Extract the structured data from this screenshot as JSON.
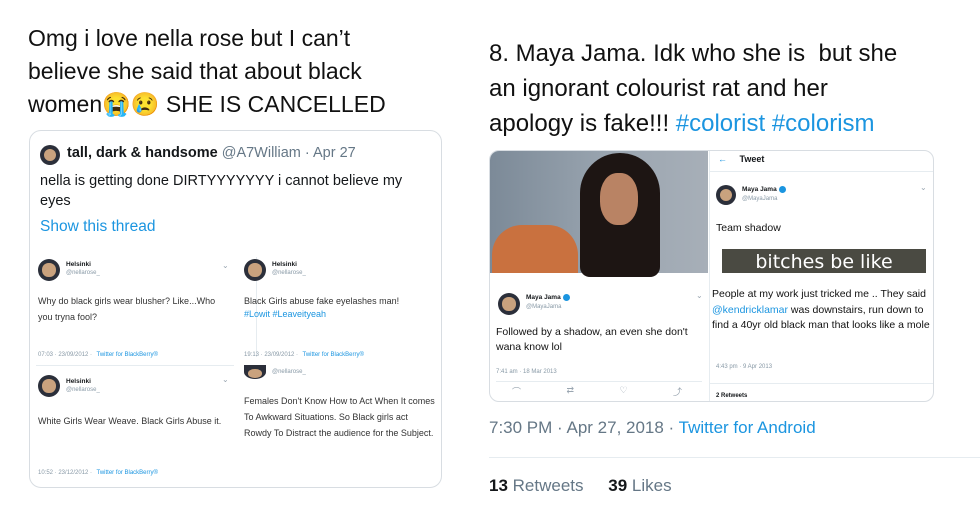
{
  "left": {
    "caption": {
      "line1": "Omg i love nella rose but I can’t",
      "line2": "believe she said that about black",
      "line3_start": "women",
      "emoji1": "😭",
      "emoji2": "😢",
      "line3_end": "SHE IS CANCELLED"
    },
    "tweet": {
      "display_name": "tall, dark & handsome",
      "handle": "@A7William",
      "date": "· Apr 27",
      "text": "nella is getting done DIRTYYYYYYY i cannot believe my eyes",
      "show_thread": "Show this thread",
      "embedded": [
        {
          "name": "Helsinki",
          "handle": "@nellarose_",
          "text": "Why do black girls wear blusher? Like...Who you tryna fool?",
          "tags": "",
          "time": "07:03 · 23/09/2012 ·",
          "source": "Twitter for BlackBerry®"
        },
        {
          "name": "Helsinki",
          "handle": "@nellarose_",
          "text": "Black Girls abuse fake eyelashes man!",
          "tags": "#Lowit #Leaveityeah",
          "time": "19:13 · 23/09/2012 ·",
          "source": "Twitter for BlackBerry®"
        },
        {
          "name": "Helsinki",
          "handle": "@nellarose_",
          "text": "White Girls Wear Weave. Black Girls Abuse it.",
          "tags": "",
          "time": "10:52 · 23/12/2012 ·",
          "source": "Twitter for BlackBerry®"
        },
        {
          "name": "",
          "handle": "@nellarose_",
          "text": "Females Don't Know How to Act When It comes To Awkward Situations. So Black girls act Rowdy To Distract the audience for the Subject.",
          "tags": "",
          "time": "",
          "source": ""
        }
      ]
    }
  },
  "right": {
    "caption": {
      "line1": "8. Maya Jama. Idk who she is  but she",
      "line2": "an ignorant colourist rat and her",
      "line3_start": "apology is fake!!!",
      "hashtag1": "#colorist",
      "hashtag2": "#colorism"
    },
    "photo_tweet": {
      "name": "Maya Jama",
      "handle": "@MayaJama",
      "text": "Followed by a shadow, an even she don't wana know lol",
      "time": "7:41 am · 18 Mar 2013"
    },
    "tweet_panel": {
      "header": "Tweet",
      "name": "Maya Jama",
      "handle": "@MayaJama",
      "text": "Team shadow",
      "meme_caption": "bitches be like",
      "second_text_a": "People at my work just tricked me .. They said ",
      "mention": "@kendricklamar",
      "second_text_b": " was downstairs, run down to find a 40yr old black man that looks like a mole",
      "second_time": "4:43 pm · 9 Apr 2013",
      "retweets_cut": "2 Retweets"
    },
    "meta": {
      "time_date": "7:30 PM · Apr 27, 2018 ·",
      "source": "Twitter for Android",
      "retweets_count": "13",
      "retweets_label": "Retweets",
      "likes_count": "39",
      "likes_label": "Likes"
    }
  }
}
